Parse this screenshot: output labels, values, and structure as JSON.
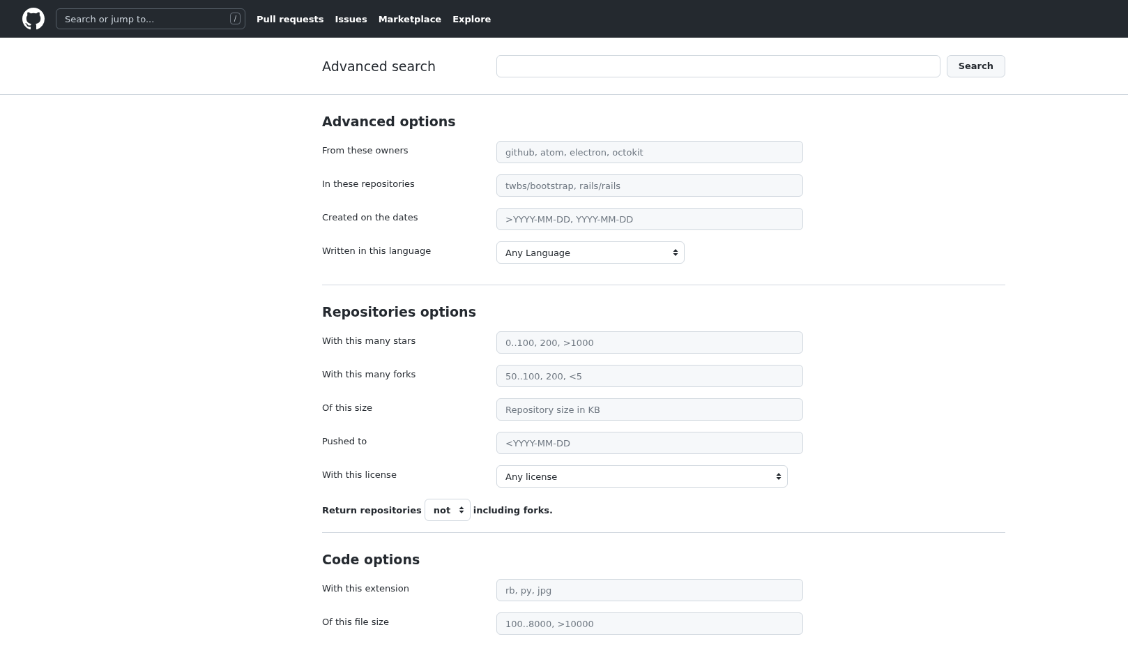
{
  "header": {
    "search": {
      "placeholder": "Search or jump to...",
      "key_hint": "/"
    },
    "nav": [
      "Pull requests",
      "Issues",
      "Marketplace",
      "Explore"
    ]
  },
  "search_bar": {
    "title": "Advanced search",
    "button": "Search"
  },
  "sections": [
    {
      "title": "Advanced options",
      "rows": [
        {
          "kind": "text",
          "label": "From these owners",
          "placeholder": "github, atom, electron, octokit"
        },
        {
          "kind": "text",
          "label": "In these repositories",
          "placeholder": "twbs/bootstrap, rails/rails"
        },
        {
          "kind": "text",
          "label": "Created on the dates",
          "placeholder": ">YYYY-MM-DD, YYYY-MM-DD"
        },
        {
          "kind": "select",
          "label": "Written in this language",
          "value": "Any Language"
        }
      ]
    },
    {
      "title": "Repositories options",
      "rows": [
        {
          "kind": "text",
          "label": "With this many stars",
          "placeholder": "0..100, 200, >1000"
        },
        {
          "kind": "text",
          "label": "With this many forks",
          "placeholder": "50..100, 200, <5"
        },
        {
          "kind": "text",
          "label": "Of this size",
          "placeholder": "Repository size in KB"
        },
        {
          "kind": "text",
          "label": "Pushed to",
          "placeholder": "<YYYY-MM-DD"
        },
        {
          "kind": "select",
          "label": "With this license",
          "value": "Any license"
        },
        {
          "kind": "sentence",
          "before": "Return repositories",
          "value": "not",
          "after": "including forks."
        }
      ]
    },
    {
      "title": "Code options",
      "rows": [
        {
          "kind": "text",
          "label": "With this extension",
          "placeholder": "rb, py, jpg"
        },
        {
          "kind": "text",
          "label": "Of this file size",
          "placeholder": "100..8000, >10000"
        }
      ]
    }
  ]
}
